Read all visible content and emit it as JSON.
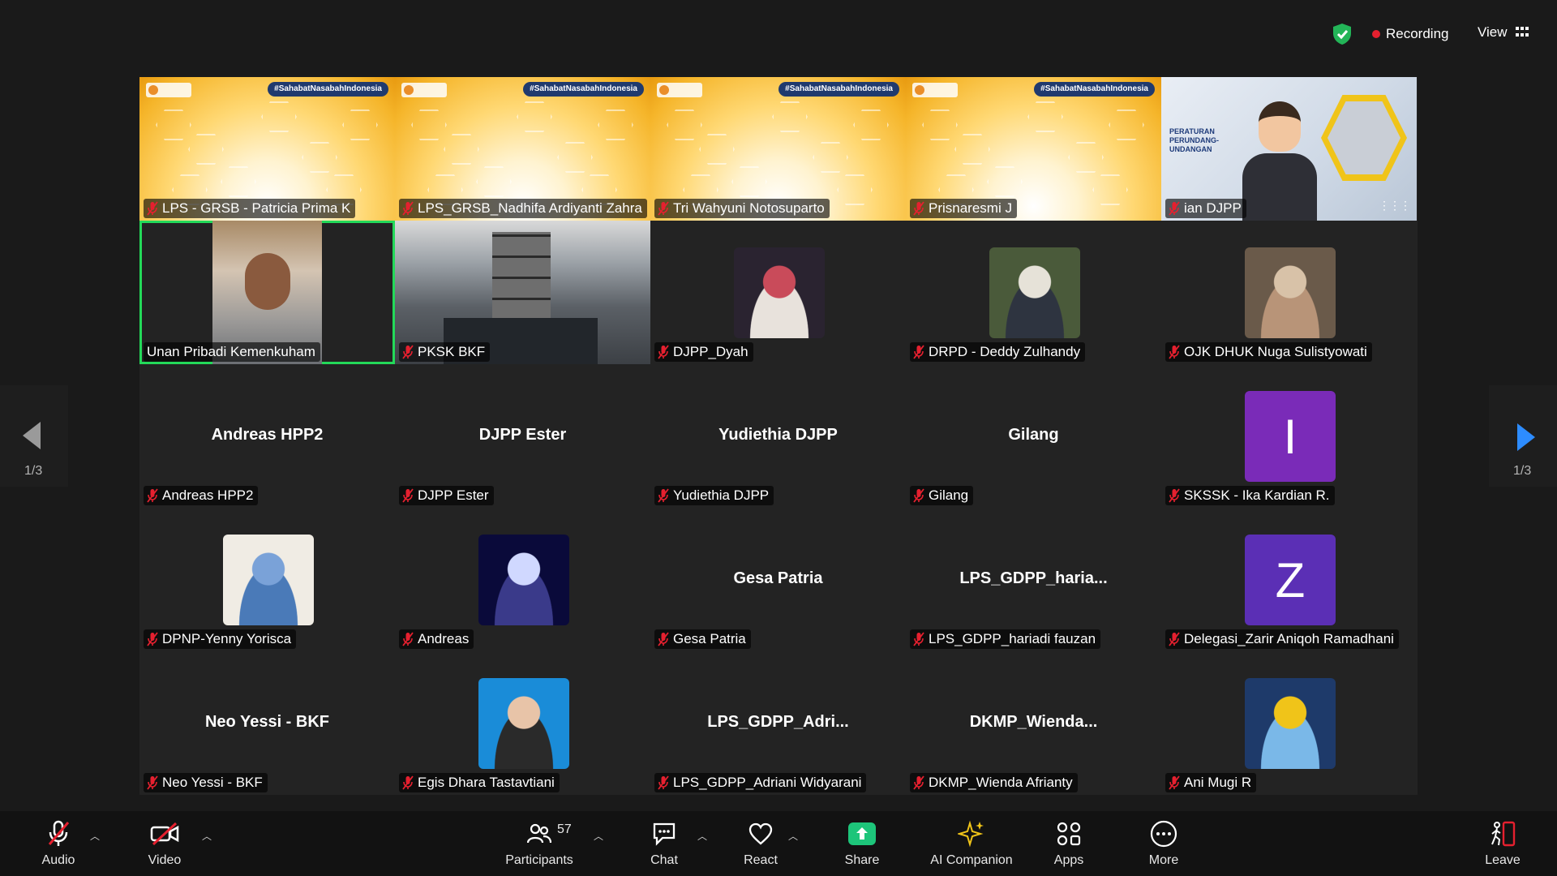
{
  "header": {
    "recording_label": "Recording",
    "view_label": "View"
  },
  "tiles": [
    {
      "name": "LPS - GRSB - Patricia Prima K",
      "kind": "lps",
      "tag": "#SahabatNasabahIndonesia"
    },
    {
      "name": "LPS_GRSB_Nadhifa Ardiyanti Zahra",
      "kind": "lps",
      "tag": "#SahabatNasabahIndonesia"
    },
    {
      "name": "Tri Wahyuni Notosuparto",
      "kind": "lps",
      "tag": "#SahabatNasabahIndonesia"
    },
    {
      "name": "Prisnaresmi J",
      "kind": "lps",
      "tag": "#SahabatNasabahIndonesia"
    },
    {
      "name": "ian DJPP",
      "kind": "djpp",
      "banner": "PERATURAN PERUNDANG-UNDANGAN"
    },
    {
      "name": "Unan Pribadi Kemenkuham",
      "kind": "camera",
      "active": true
    },
    {
      "name": "PKSK BKF",
      "kind": "office"
    },
    {
      "name": "DJPP_Dyah",
      "kind": "photo"
    },
    {
      "name": "DRPD - Deddy Zulhandy",
      "kind": "photo"
    },
    {
      "name": "OJK DHUK Nuga Sulistyowati",
      "kind": "photo"
    },
    {
      "name": "Andreas HPP2",
      "kind": "text",
      "center": "Andreas HPP2"
    },
    {
      "name": "DJPP Ester",
      "kind": "text",
      "center": "DJPP Ester"
    },
    {
      "name": "Yudiethia DJPP",
      "kind": "text",
      "center": "Yudiethia DJPP"
    },
    {
      "name": "Gilang",
      "kind": "text",
      "center": "Gilang"
    },
    {
      "name": "SKSSK - Ika Kardian R.",
      "kind": "letter",
      "letter": "I",
      "color": "#7a2bb8"
    },
    {
      "name": "DPNP-Yenny Yorisca",
      "kind": "photo"
    },
    {
      "name": "Andreas",
      "kind": "photo"
    },
    {
      "name": "Gesa Patria",
      "kind": "text",
      "center": "Gesa Patria"
    },
    {
      "name": "LPS_GDPP_hariadi fauzan",
      "kind": "text",
      "center": "LPS_GDPP_haria..."
    },
    {
      "name": "Delegasi_Zarir Aniqoh Ramadhani",
      "kind": "letter",
      "letter": "Z",
      "color": "#5b2fb5"
    },
    {
      "name": "Neo Yessi - BKF",
      "kind": "text",
      "center": "Neo Yessi - BKF"
    },
    {
      "name": "Egis Dhara Tastavtiani",
      "kind": "photo"
    },
    {
      "name": "LPS_GDPP_Adriani Widyarani",
      "kind": "text",
      "center": "LPS_GDPP_Adri..."
    },
    {
      "name": "DKMP_Wienda Afrianty",
      "kind": "text",
      "center": "DKMP_Wienda..."
    },
    {
      "name": "Ani Mugi R",
      "kind": "photo"
    }
  ],
  "pagination": {
    "left": "1/3",
    "right": "1/3"
  },
  "toolbar": {
    "audio": "Audio",
    "video": "Video",
    "participants": "Participants",
    "participant_count": "57",
    "chat": "Chat",
    "react": "React",
    "share": "Share",
    "ai": "AI Companion",
    "apps": "Apps",
    "more": "More",
    "leave": "Leave"
  },
  "colors": {
    "share_green": "#1dc57a",
    "active_border": "#23d959",
    "recording_red": "#e5202f",
    "nav_blue": "#2d8cff",
    "leave_red": "#e5202f"
  }
}
